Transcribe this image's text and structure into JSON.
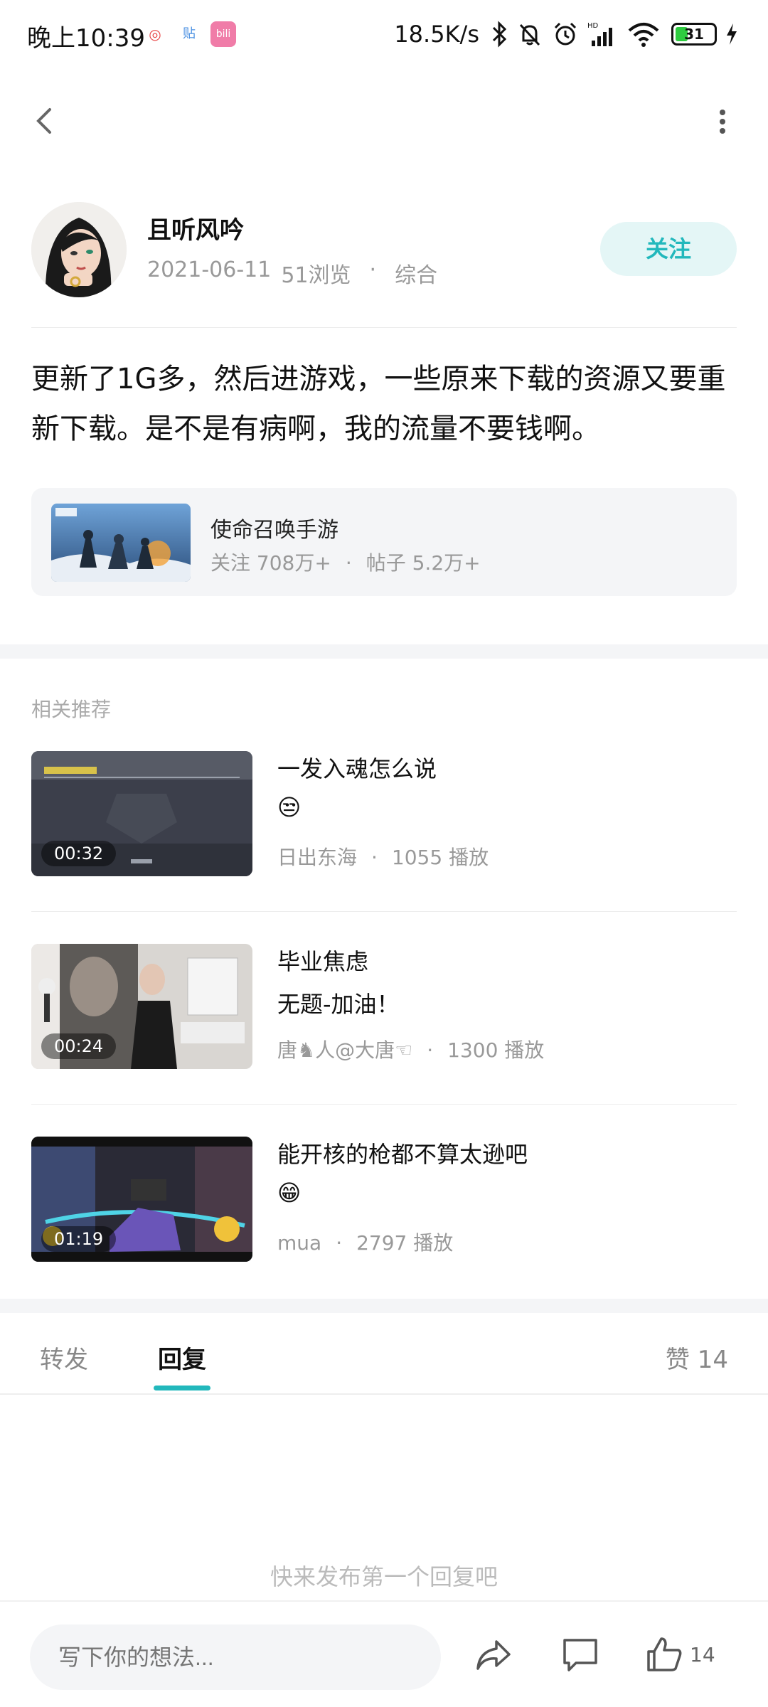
{
  "status_bar": {
    "time": "晚上10:39",
    "network_speed": "18.5K/s",
    "battery_level": "31",
    "app_badges": [
      "weibo-icon",
      "tieba-icon",
      "bilibili-icon"
    ]
  },
  "author": {
    "name": "且听风吟",
    "date": "2021-06-11",
    "views": "51浏览",
    "category": "综合",
    "follow_label": "关注"
  },
  "post": {
    "text": "更新了1G多，然后进游戏，一些原来下载的资源又要重新下载。是不是有病啊，我的流量不要钱啊。"
  },
  "game_card": {
    "name": "使命召唤手游",
    "followers": "关注 708万+",
    "posts": "帖子 5.2万+"
  },
  "recommendations": {
    "title": "相关推荐",
    "items": [
      {
        "title": "一发入魂怎么说",
        "subtitle": "😒",
        "author": "日出东海",
        "plays": "1055 播放",
        "duration": "00:32"
      },
      {
        "title": "毕业焦虑",
        "subtitle": "无题-加油！",
        "author": "唐♞人@大唐☜",
        "plays": "1300 播放",
        "duration": "00:24"
      },
      {
        "title": "能开核的枪都不算太逊吧",
        "subtitle": "😁",
        "author": "mua",
        "plays": "2797 播放",
        "duration": "01:19"
      }
    ]
  },
  "tabs": {
    "repost": "转发",
    "reply": "回复",
    "likes": "赞 14"
  },
  "empty_state": "快来发布第一个回复吧",
  "bottom_bar": {
    "input_placeholder": "写下你的想法...",
    "like_count": "14"
  },
  "colors": {
    "accent": "#22b8bc",
    "follow_bg": "#e4f6f6",
    "card_bg": "#f4f5f7"
  }
}
